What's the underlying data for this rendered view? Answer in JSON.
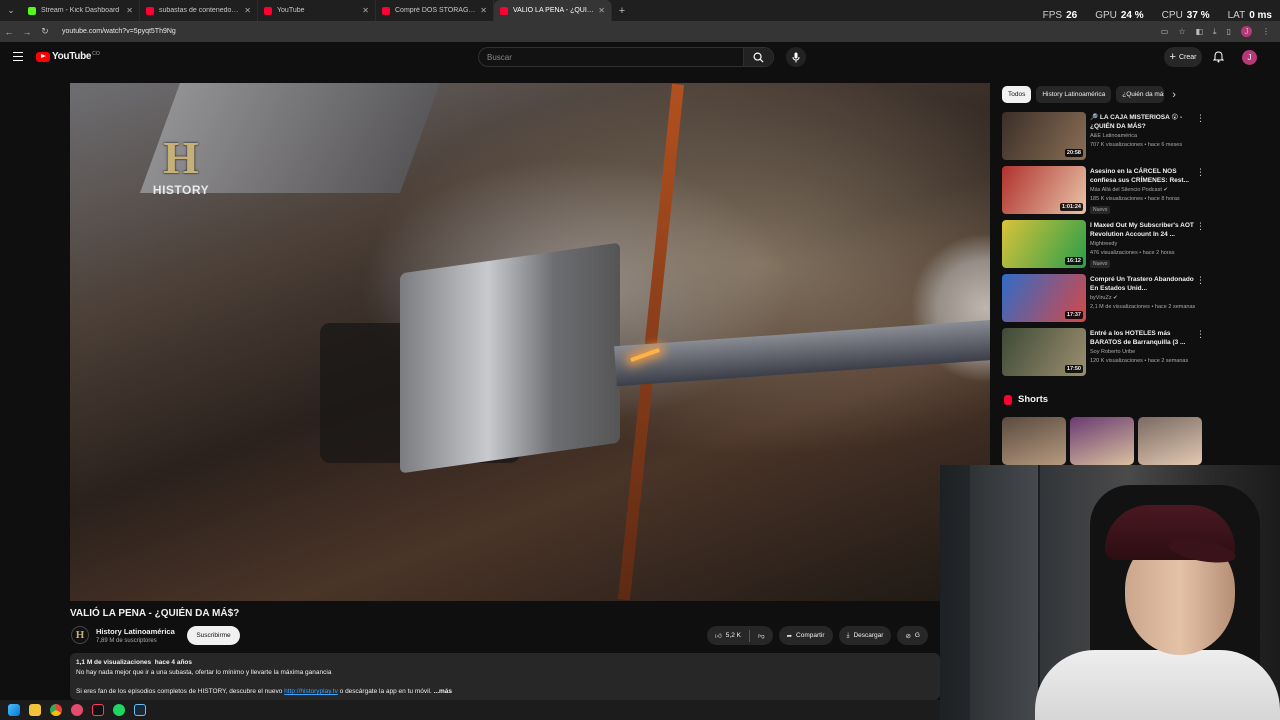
{
  "browser": {
    "tabs": [
      {
        "label": "Stream - Kick Dashboard",
        "color": "#53fc18",
        "active": false
      },
      {
        "label": "subastas de contenedores - Yo",
        "color": "#ff0033",
        "active": false
      },
      {
        "label": "YouTube",
        "color": "#ff0033",
        "active": false
      },
      {
        "label": "Compré DOS STORAGES: uno d",
        "color": "#ff0033",
        "active": false
      },
      {
        "label": "VALIÓ LA PENA - ¿QUIÉN DA M",
        "color": "#ff0033",
        "active": true
      }
    ],
    "new_tab": "+",
    "url": "youtube.com/watch?v=5pyqt5Th9Ng"
  },
  "hud": {
    "fps_label": "FPS",
    "fps": "26",
    "gpu_label": "GPU",
    "gpu": "24 %",
    "cpu_label": "CPU",
    "cpu": "37 %",
    "lat_label": "LAT",
    "lat": "0 ms"
  },
  "youtube": {
    "logo": "YouTube",
    "country": "CO",
    "search_placeholder": "Buscar",
    "create_label": "Crear",
    "avatar_letter": "J"
  },
  "video": {
    "watermark_letter": "H",
    "watermark_text": "HISTORY",
    "title": "VALIÓ LA PENA - ¿QUIÉN DA MÁ$?",
    "channel": "History Latinoamérica",
    "channel_avatar": "H",
    "subscribers": "7,89 M de suscriptores",
    "subscribe_label": "Suscribirme",
    "likes": "5,2 K",
    "share_label": "Compartir",
    "download_label": "Descargar",
    "clip_partial": "G"
  },
  "description": {
    "views": "1,1 M de visualizaciones",
    "age": "hace 4 años",
    "line1": "No hay nada mejor que ir a una subasta, ofertar lo mínimo y llevarte la máxima ganancia",
    "line2_prefix": "Si eres fan de los episodios completos de HISTORY, descubre el nuevo ",
    "line2_link": "http://historyplay.tv",
    "line2_suffix": " o descárgate la app en tu móvil.",
    "more": "...más"
  },
  "sidebar": {
    "chips": [
      "Todos",
      "History Latinoamérica",
      "¿Quién da más"
    ],
    "items": [
      {
        "title": "🔎 LA CAJA MISTERIOSA 😮 - ¿QUIÉN DA MÁS?",
        "channel": "A&E Latinoamérica",
        "meta": "707 K visualizaciones • hace 6 meses",
        "duration": "20:58",
        "badge": "",
        "c1": "#3b2f28",
        "c2": "#8a6e55"
      },
      {
        "title": "Asesino en la CÁRCEL NOS confiesa sus CRÍMENES: Rest...",
        "channel": "Más Allá del Silencio Podcast ✔",
        "meta": "185 K visualizaciones • hace 8 horas",
        "duration": "1:01:24",
        "badge": "Nuevo",
        "c1": "#b0322e",
        "c2": "#e8c4a8"
      },
      {
        "title": "I Maxed Out My Subscriber's AOT Revolution Account In 24 ...",
        "channel": "Mightreedy",
        "meta": "476 visualizaciones • hace 2 horas",
        "duration": "16:12",
        "badge": "Nuevo",
        "c1": "#d8c23a",
        "c2": "#2a9e4a"
      },
      {
        "title": "Compré Un Trastero Abandonado En Estados Unid...",
        "channel": "byViruZz ✔",
        "meta": "2,1 M de visualizaciones • hace 2 semanas",
        "duration": "17:37",
        "badge": "",
        "c1": "#2f6cc7",
        "c2": "#d54848"
      },
      {
        "title": "Entré a los HOTELES más BARATOS de Barranquilla (3 ...",
        "channel": "Soy Roberto Uribe",
        "meta": "120 K visualizaciones • hace 2 semanas",
        "duration": "17:50",
        "badge": "",
        "c1": "#3e4a36",
        "c2": "#9c8f70"
      }
    ],
    "shorts_label": "Shorts",
    "shorts": [
      {
        "c1": "#5a4a3f",
        "c2": "#b79a7f"
      },
      {
        "c1": "#6a3a72",
        "c2": "#d9c19e"
      },
      {
        "c1": "#7a6a63",
        "c2": "#e3c9b2"
      }
    ]
  },
  "colors": {
    "accent": "#ff0000",
    "link": "#3ea6ff",
    "bg": "#0f0f0f"
  }
}
